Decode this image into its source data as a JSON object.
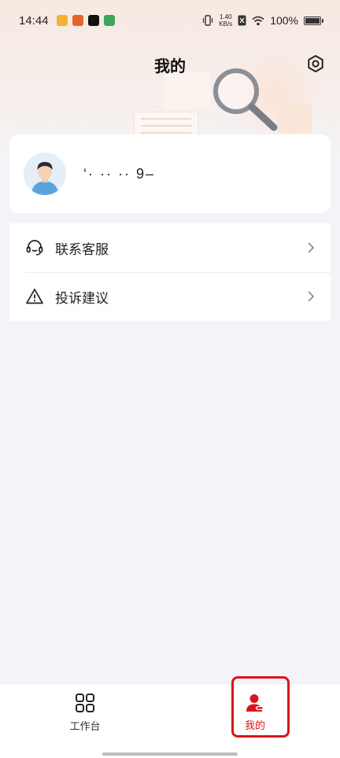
{
  "status_bar": {
    "time": "14:44",
    "net_speed_value": "1.40",
    "net_speed_unit": "KB/s",
    "battery": "100%"
  },
  "header": {
    "title": "我的"
  },
  "profile": {
    "username": "‘·  ··  ·· 9–"
  },
  "menu": {
    "items": [
      {
        "label": "联系客服",
        "icon": "headset-icon"
      },
      {
        "label": "投诉建议",
        "icon": "warning-icon"
      }
    ]
  },
  "tab_bar": {
    "tabs": [
      {
        "label": "工作台",
        "icon": "grid-icon",
        "active": false
      },
      {
        "label": "我的",
        "icon": "person-icon",
        "active": true
      }
    ]
  },
  "colors": {
    "accent": "#d9141b",
    "background": "#f4f4f8"
  }
}
